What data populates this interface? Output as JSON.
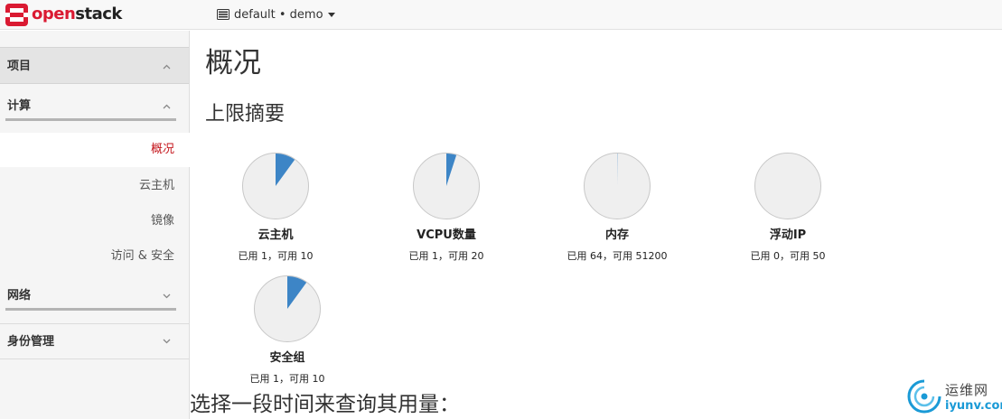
{
  "navbar": {
    "brand_part1": "open",
    "brand_part2": "stack",
    "project_switcher": "default • demo",
    "icons": [
      "openstack-logo-icon",
      "server-icon",
      "caret-down-icon"
    ],
    "brand_color": "#da1a32"
  },
  "sidebar": {
    "project": "项目",
    "compute": "计算",
    "items": [
      {
        "label": "概况",
        "active": true
      },
      {
        "label": "云主机",
        "active": false
      },
      {
        "label": "镜像",
        "active": false
      },
      {
        "label": "访问 & 安全",
        "active": false
      }
    ],
    "network": "网络",
    "identity": "身份管理",
    "active_color": "#c4161c"
  },
  "main": {
    "page_title": "概况",
    "limits_title": "上限摘要",
    "range_title": "选择一段时间来查询其用量："
  },
  "quotas": [
    {
      "name": "云主机",
      "usage_text": "已用 1，可用 10",
      "used": 1,
      "available": 10
    },
    {
      "name": "VCPU数量",
      "usage_text": "已用 1，可用 20",
      "used": 1,
      "available": 20
    },
    {
      "name": "内存",
      "usage_text": "已用 64，可用 51200",
      "used": 64,
      "available": 51200
    },
    {
      "name": "浮动IP",
      "usage_text": "已用 0，可用 50",
      "used": 0,
      "available": 50
    },
    {
      "name": "安全组",
      "usage_text": "已用 1，可用 10",
      "used": 1,
      "available": 10
    }
  ],
  "pie_colors": {
    "used": "#3d85c6",
    "free": "#efefef",
    "border": "#c8c8c8"
  },
  "watermark": {
    "cn": "运维网",
    "en": "iyunv.com"
  }
}
